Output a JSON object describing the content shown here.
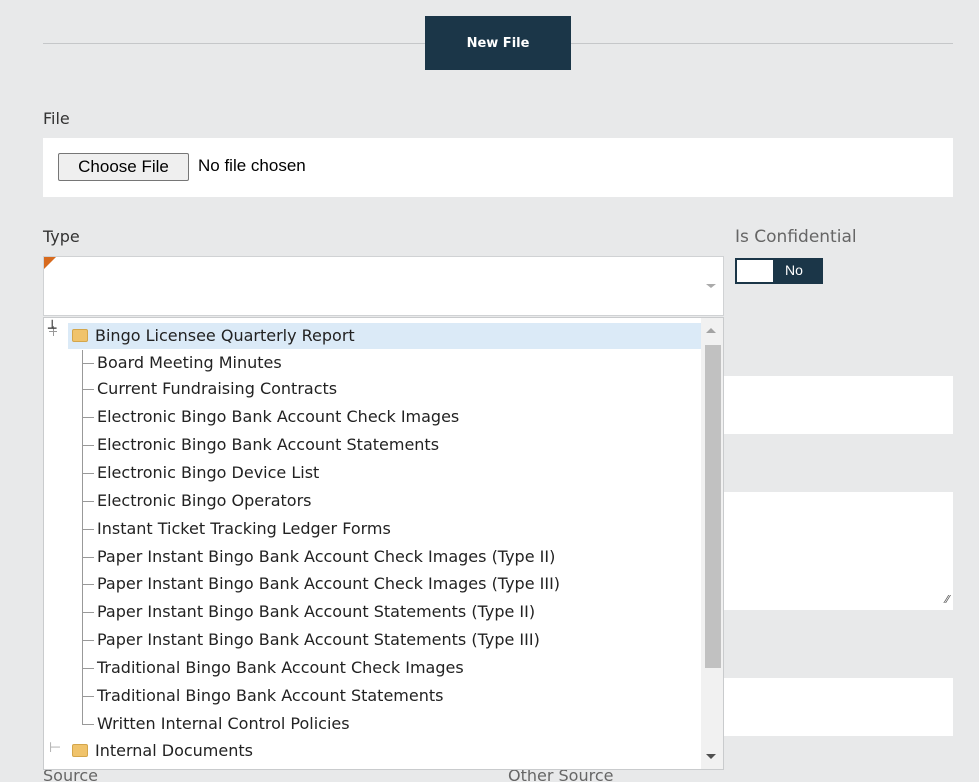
{
  "header": {
    "new_file_label": "New File"
  },
  "file": {
    "label": "File",
    "choose_label": "Choose File",
    "status": "No file chosen"
  },
  "type": {
    "label": "Type",
    "value": ""
  },
  "confidential": {
    "label": "Is Confidential",
    "value": "No"
  },
  "dropdown": {
    "groups": [
      {
        "label": "Bingo Licensee Quarterly Report",
        "expanded": true,
        "items": [
          "Board Meeting Minutes",
          "Current Fundraising Contracts",
          "Electronic Bingo Bank Account Check Images",
          "Electronic Bingo Bank Account Statements",
          "Electronic Bingo Device List",
          "Electronic Bingo Operators",
          "Instant Ticket Tracking Ledger Forms",
          "Paper Instant Bingo Bank Account Check Images (Type II)",
          "Paper Instant Bingo Bank Account Check Images (Type III)",
          "Paper Instant Bingo Bank Account Statements (Type II)",
          "Paper Instant Bingo Bank Account Statements (Type III)",
          "Traditional Bingo Bank Account Check Images",
          "Traditional Bingo Bank Account Statements",
          "Written Internal Control Policies"
        ]
      },
      {
        "label": "Internal Documents",
        "expanded": false
      }
    ]
  },
  "footer_labels": {
    "source": "Source",
    "other_source": "Other Source"
  },
  "colors": {
    "primary": "#1b3648",
    "required": "#d76a1e",
    "selected_row": "#dbeaf7"
  }
}
